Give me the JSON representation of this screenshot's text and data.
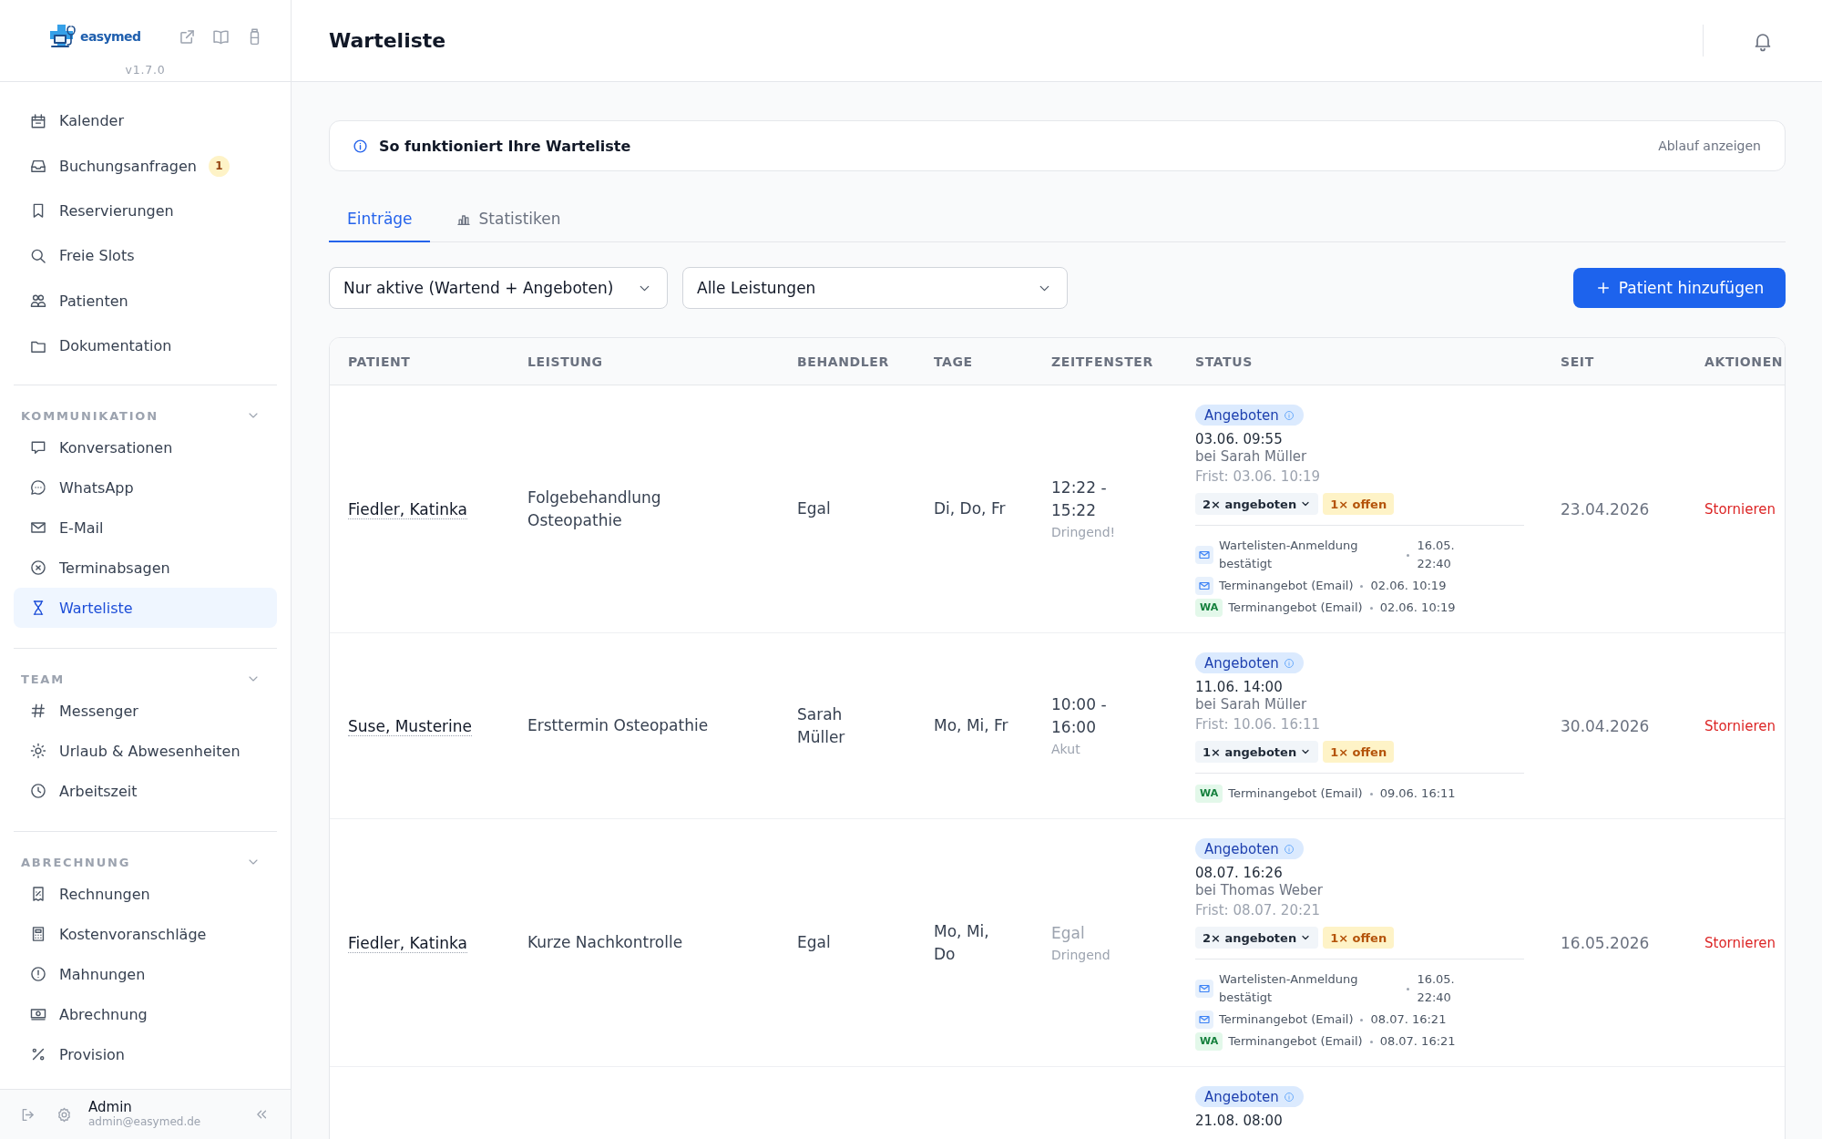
{
  "sidebar": {
    "logo": "easymed",
    "version": "v1.7.0",
    "nav": [
      {
        "label": "Kalender",
        "selected": false
      },
      {
        "label": "Buchungsanfragen",
        "badge": "1",
        "selected": false
      },
      {
        "label": "Reservierungen",
        "selected": false
      },
      {
        "label": "Freie Slots",
        "selected": false
      },
      {
        "label": "Patienten",
        "selected": false
      },
      {
        "label": "Dokumentation",
        "selected": false
      }
    ],
    "sections": [
      {
        "title": "KOMMUNIKATION",
        "expanded": true,
        "items": [
          {
            "label": "Konversationen",
            "selected": false
          },
          {
            "label": "WhatsApp",
            "selected": false
          },
          {
            "label": "E-Mail",
            "selected": false
          },
          {
            "label": "Terminabsagen",
            "selected": false
          },
          {
            "label": "Warteliste",
            "selected": true
          }
        ]
      },
      {
        "title": "TEAM",
        "expanded": true,
        "items": [
          {
            "label": "Messenger",
            "selected": false
          },
          {
            "label": "Urlaub & Abwesenheiten",
            "selected": false
          },
          {
            "label": "Arbeitszeit",
            "selected": false
          }
        ]
      },
      {
        "title": "ABRECHNUNG",
        "expanded": true,
        "items": [
          {
            "label": "Rechnungen",
            "selected": false
          },
          {
            "label": "Kostenvoranschläge",
            "selected": false
          },
          {
            "label": "Mahnungen",
            "selected": false
          },
          {
            "label": "Abrechnung",
            "selected": false
          },
          {
            "label": "Provision",
            "selected": false
          }
        ]
      }
    ],
    "user": {
      "name": "Admin",
      "email": "admin@easymed.de"
    }
  },
  "header": {
    "title": "Warteliste"
  },
  "info_banner": {
    "title": "So funktioniert Ihre Warteliste",
    "action": "Ablauf anzeigen"
  },
  "tabs": [
    {
      "label": "Einträge",
      "selected": true
    },
    {
      "label": "Statistiken",
      "selected": false
    }
  ],
  "filters": [
    {
      "value": "Nur aktive (Wartend + Angeboten)"
    },
    {
      "value": "Alle Leistungen"
    }
  ],
  "add_button": "Patient hinzufügen",
  "table": {
    "columns": [
      "PATIENT",
      "LEISTUNG",
      "BEHANDLER",
      "TAGE",
      "ZEITFENSTER",
      "STATUS",
      "SEIT",
      "AKTIONEN"
    ],
    "rows": [
      {
        "patient": "Fiedler, Katinka",
        "service": "Folgebehandlung Osteopathie",
        "provider": "Egal",
        "days": "Di, Do, Fr",
        "time_window": {
          "kind": "range",
          "text": "12:22 - 15:22"
        },
        "urgency": "Dringend!",
        "status": {
          "label": "Angeboten",
          "offer_time": "03.06. 09:55",
          "offer_provider": "bei Sarah Müller",
          "deadline": "Frist: 03.06. 10:19",
          "offered_count": "2× angeboten",
          "open_count": "1× offen",
          "log": [
            {
              "kind": "email",
              "text": "Wartelisten-Anmeldung bestätigt",
              "time": "16.05. 22:40"
            },
            {
              "kind": "email",
              "text": "Terminangebot (Email)",
              "time": "02.06. 10:19"
            },
            {
              "kind": "whatsapp",
              "tag": "WA",
              "text": "Terminangebot (Email)",
              "time": "02.06. 10:19"
            }
          ]
        },
        "since": "23.04.2026",
        "action": "Stornieren"
      },
      {
        "patient": "Suse, Musterine",
        "service": "Ersttermin Osteopathie",
        "provider": "Sarah Müller",
        "days": "Mo, Mi, Fr",
        "time_window": {
          "kind": "range",
          "text": "10:00 - 16:00"
        },
        "urgency": "Akut",
        "status": {
          "label": "Angeboten",
          "offer_time": "11.06. 14:00",
          "offer_provider": "bei Sarah Müller",
          "deadline": "Frist: 10.06. 16:11",
          "offered_count": "1× angeboten",
          "open_count": "1× offen",
          "log": [
            {
              "kind": "whatsapp",
              "tag": "WA",
              "text": "Terminangebot (Email)",
              "time": "09.06. 16:11"
            }
          ]
        },
        "since": "30.04.2026",
        "action": "Stornieren"
      },
      {
        "patient": "Fiedler, Katinka",
        "service": "Kurze Nachkontrolle",
        "provider": "Egal",
        "days": "Mo, Mi, Do",
        "time_window": {
          "kind": "any",
          "text": "Egal"
        },
        "urgency": "Dringend",
        "status": {
          "label": "Angeboten",
          "offer_time": "08.07. 16:26",
          "offer_provider": "bei Thomas Weber",
          "deadline": "Frist: 08.07. 20:21",
          "offered_count": "2× angeboten",
          "open_count": "1× offen",
          "log": [
            {
              "kind": "email",
              "text": "Wartelisten-Anmeldung bestätigt",
              "time": "16.05. 22:40"
            },
            {
              "kind": "email",
              "text": "Terminangebot (Email)",
              "time": "08.07. 16:21"
            },
            {
              "kind": "whatsapp",
              "tag": "WA",
              "text": "Terminangebot (Email)",
              "time": "08.07. 16:21"
            }
          ]
        },
        "since": "16.05.2026",
        "action": "Stornieren"
      },
      {
        "status": {
          "label": "Angeboten",
          "offer_time": "21.08. 08:00"
        }
      }
    ]
  }
}
